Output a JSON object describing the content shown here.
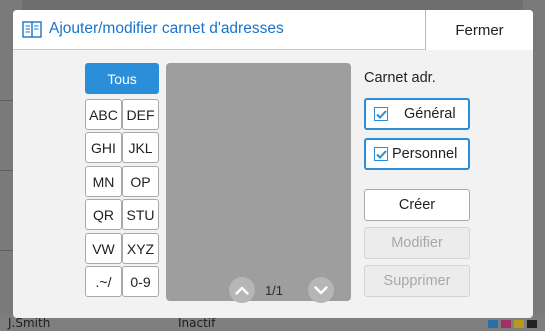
{
  "dialog": {
    "title": "Ajouter/modifier carnet d'adresses",
    "close_label": "Fermer"
  },
  "alpha_index": {
    "selected": "Tous",
    "buttons": [
      "Tous",
      "ABC",
      "DEF",
      "GHI",
      "JKL",
      "MN",
      "OP",
      "QR",
      "STU",
      "VW",
      "XYZ",
      ".~/",
      "0-9"
    ]
  },
  "pagination": {
    "page_label": "1/1",
    "current_page": 1,
    "total_pages": 1
  },
  "address_books": {
    "label": "Carnet adr.",
    "general": {
      "label": "Général",
      "checked": true
    },
    "personal": {
      "label": "Personnel",
      "checked": true
    }
  },
  "actions": {
    "create": "Créer",
    "modify": "Modifier",
    "delete": "Supprimer"
  },
  "background": {
    "user": "J.Smith",
    "status": "Inactif"
  },
  "colors": {
    "accent": "#2a8ed8",
    "title": "#1a73c8",
    "list_panel": "#9e9e9e",
    "dialog_bg": "#f2f2f2",
    "overlay": "#6e6e6e"
  }
}
